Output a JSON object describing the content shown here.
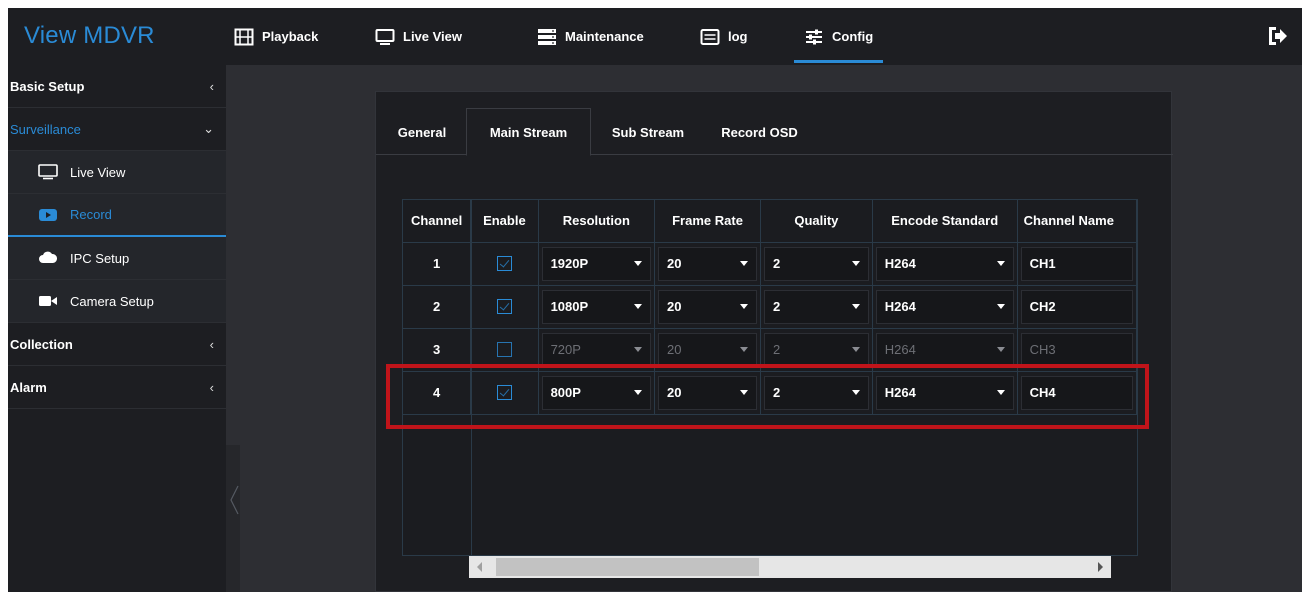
{
  "app": {
    "title": "View MDVR"
  },
  "nav": [
    {
      "label": "Playback",
      "icon": "film-icon"
    },
    {
      "label": "Live View",
      "icon": "monitor-icon"
    },
    {
      "label": "Maintenance",
      "icon": "server-icon"
    },
    {
      "label": "log",
      "icon": "list-icon"
    },
    {
      "label": "Config",
      "icon": "sliders-icon",
      "active": true
    }
  ],
  "sidebar": {
    "items": [
      {
        "label": "Basic Setup",
        "type": "group",
        "caret": "‹"
      },
      {
        "label": "Surveillance",
        "type": "group",
        "caret": "⌄",
        "expanded": true
      },
      {
        "label": "Live View",
        "type": "sub",
        "icon": "monitor-icon"
      },
      {
        "label": "Record",
        "type": "sub",
        "icon": "record-icon",
        "selected": true
      },
      {
        "label": "IPC Setup",
        "type": "sub",
        "icon": "cloud-icon"
      },
      {
        "label": "Camera Setup",
        "type": "sub",
        "icon": "camera-icon"
      },
      {
        "label": "Collection",
        "type": "group",
        "caret": "‹"
      },
      {
        "label": "Alarm",
        "type": "group",
        "caret": "‹"
      }
    ]
  },
  "tabs": [
    {
      "label": "General"
    },
    {
      "label": "Main Stream",
      "active": true
    },
    {
      "label": "Sub Stream"
    },
    {
      "label": "Record OSD"
    }
  ],
  "table": {
    "headers": [
      "Channel",
      "Enable",
      "Resolution",
      "Frame Rate",
      "Quality",
      "Encode Standard",
      "Channel Name"
    ],
    "rows": [
      {
        "channel": "1",
        "enabled": true,
        "resolution": "1920P",
        "frame_rate": "20",
        "quality": "2",
        "encode": "H264",
        "name": "CH1"
      },
      {
        "channel": "2",
        "enabled": true,
        "resolution": "1080P",
        "frame_rate": "20",
        "quality": "2",
        "encode": "H264",
        "name": "CH2"
      },
      {
        "channel": "3",
        "enabled": false,
        "resolution": "720P",
        "frame_rate": "20",
        "quality": "2",
        "encode": "H264",
        "name": "CH3"
      },
      {
        "channel": "4",
        "enabled": true,
        "resolution": "800P",
        "frame_rate": "20",
        "quality": "2",
        "encode": "H264",
        "name": "CH4"
      }
    ]
  },
  "colors": {
    "accent": "#2a8bd6",
    "highlight": "#c0141a",
    "bg_dark": "#1d1e22",
    "bg_main": "#2d2e33"
  }
}
